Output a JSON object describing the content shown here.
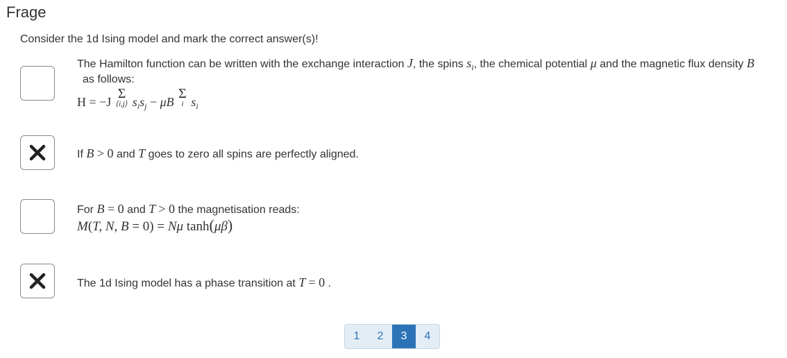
{
  "header": {
    "title": "Frage"
  },
  "question": {
    "prompt": "Consider the 1d Ising model and mark the correct answer(s)!"
  },
  "options": [
    {
      "checked": false,
      "text_a": "The Hamilton function can be written with the exchange interaction",
      "text_b": ", the spins",
      "text_c": ", the chemical potential",
      "text_d": "and the magnetic flux density",
      "text_e": "as follows:"
    },
    {
      "checked": true,
      "text_a": "If",
      "text_b": "and",
      "text_c": "goes to zero all spins are perfectly aligned."
    },
    {
      "checked": false,
      "text_a": "For",
      "text_b": "and",
      "text_c": "the magnetisation reads:"
    },
    {
      "checked": true,
      "text_a": "The 1d Ising model has a phase transition at",
      "text_b": "."
    }
  ],
  "pagination": {
    "pages": [
      "1",
      "2",
      "3",
      "4"
    ],
    "active": "3"
  },
  "colors": {
    "accent": "#2b73b6",
    "page_bg": "#e3edf5",
    "text": "#333333"
  }
}
